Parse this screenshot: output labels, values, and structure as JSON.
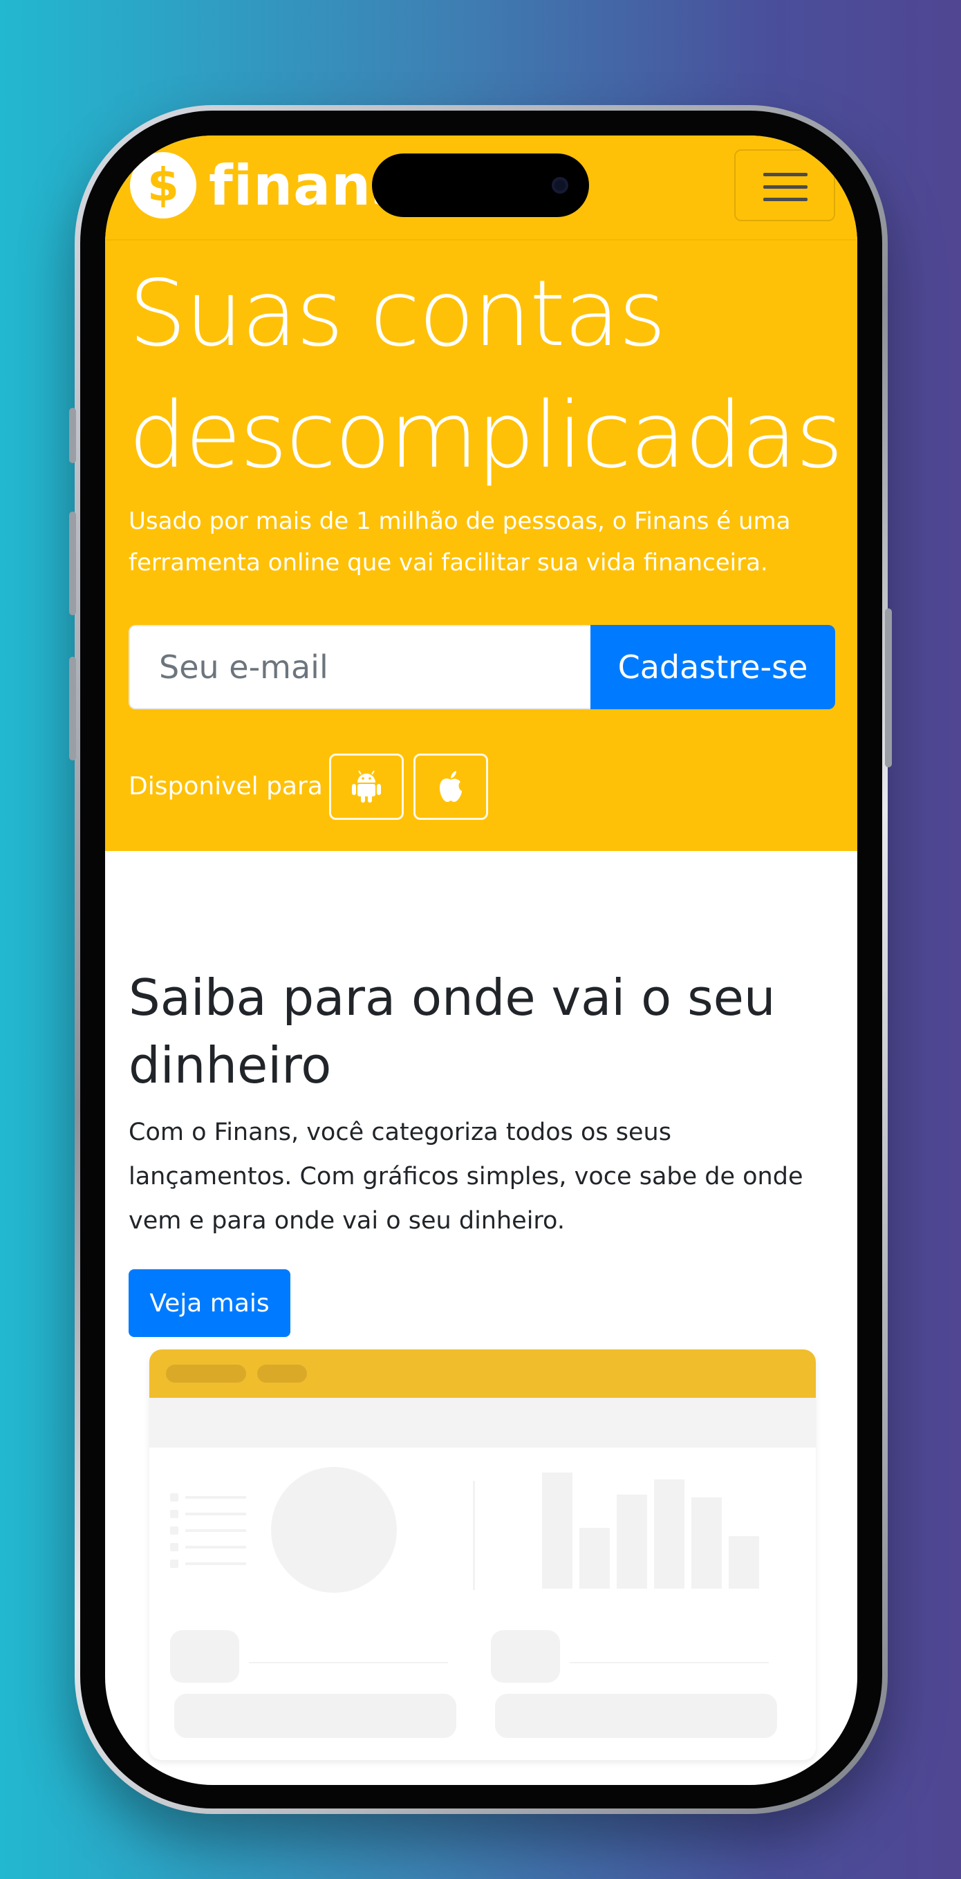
{
  "navbar": {
    "logo_symbol": "$",
    "logo_text": "finans",
    "menu_icon": "hamburger-menu-icon"
  },
  "hero": {
    "headline_line1": "Suas contas",
    "headline_line2": "descomplicadas",
    "subtitle": "Usado por mais de 1 milhão de pessoas, o Finans é uma ferramenta online que vai facilitar sua vida financeira.",
    "email_placeholder": "Seu e-mail",
    "email_value": "",
    "signup_label": "Cadastre-se",
    "available_label": "Disponivel para",
    "stores": [
      {
        "icon": "android-icon"
      },
      {
        "icon": "apple-icon"
      }
    ]
  },
  "feature": {
    "title": "Saiba para onde vai o seu dinheiro",
    "text": "Com o Finans, você categoriza todos os seus lançamentos. Com gráficos simples, voce sabe de onde vem e para onde vai o seu dinheiro.",
    "button_label": "Veja mais"
  },
  "colors": {
    "brand_yellow": "#ffc107",
    "primary_blue": "#007bff",
    "text_dark": "#212529"
  }
}
